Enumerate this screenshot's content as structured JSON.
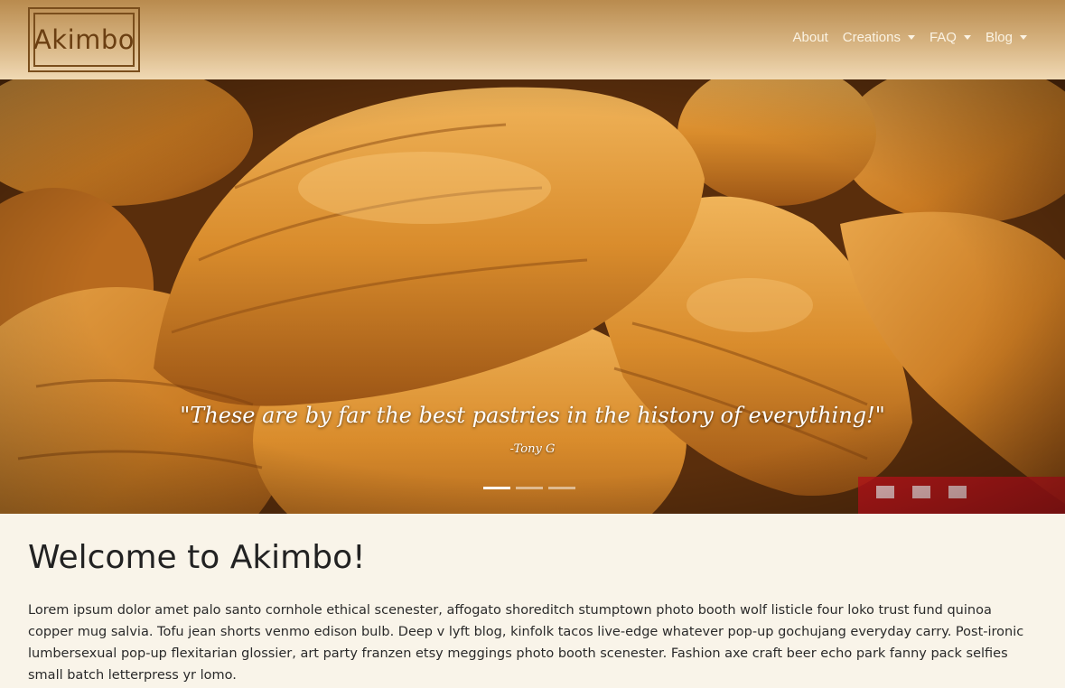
{
  "brand": {
    "name": "Akimbo"
  },
  "nav": {
    "items": [
      {
        "label": "About",
        "dropdown": false
      },
      {
        "label": "Creations",
        "dropdown": true
      },
      {
        "label": "FAQ",
        "dropdown": true
      },
      {
        "label": "Blog",
        "dropdown": true
      }
    ]
  },
  "hero": {
    "quote": "\"These are by far the best pastries in the history of everything!\"",
    "author": "-Tony G",
    "slides_count": 3,
    "active_slide": 1
  },
  "main": {
    "heading": "Welcome to Akimbo!",
    "paragraph": "Lorem ipsum dolor amet palo santo cornhole ethical scenester, affogato shoreditch stumptown photo booth wolf listicle four loko trust fund quinoa copper mug salvia. Tofu jean shorts venmo edison bulb. Deep v lyft blog, kinfolk tacos live-edge whatever pop-up gochujang everyday carry. Post-ironic lumbersexual pop-up flexitarian glossier, art party franzen etsy meggings photo booth scenester. Fashion axe craft beer echo park fanny pack selfies small batch letterpress yr lomo."
  },
  "colors": {
    "page_background": "#f9f4e9",
    "navbar_top": "#b98b4e",
    "navbar_bottom": "#f0d9b4",
    "brand": "#6b3f12",
    "nav_text": "#fbf3e3"
  }
}
